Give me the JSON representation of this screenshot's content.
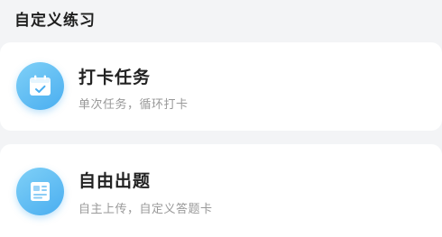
{
  "section": {
    "title": "自定义练习"
  },
  "cards": [
    {
      "title": "打卡任务",
      "subtitle": "单次任务，循环打卡",
      "icon": "calendar-check-icon"
    },
    {
      "title": "自由出题",
      "subtitle": "自主上传，自定义答题卡",
      "icon": "answer-sheet-icon"
    }
  ],
  "colors": {
    "icon_gradient_start": "#7fd0f7",
    "icon_gradient_end": "#4aaef0",
    "background": "#f3f4f6",
    "title_text": "#222222",
    "subtitle_text": "#999999"
  }
}
